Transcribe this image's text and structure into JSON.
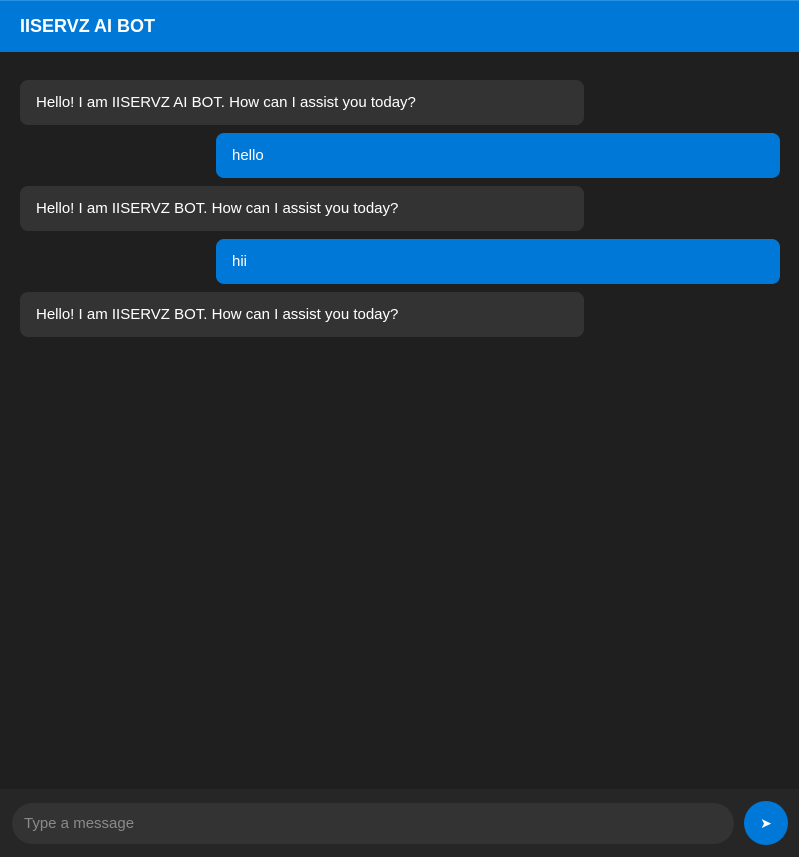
{
  "header": {
    "title": "IISERVZ AI BOT"
  },
  "messages": [
    {
      "role": "bot",
      "text": "Hello! I am IISERVZ AI BOT. How can I assist you today?"
    },
    {
      "role": "user",
      "text": "hello"
    },
    {
      "role": "bot",
      "text": "Hello! I am IISERVZ BOT. How can I assist you today?"
    },
    {
      "role": "user",
      "text": "hii"
    },
    {
      "role": "bot",
      "text": "Hello! I am IISERVZ BOT. How can I assist you today?"
    }
  ],
  "composer": {
    "value": "",
    "placeholder": "Type a message",
    "send_icon": "➤"
  },
  "colors": {
    "accent": "#0078d7",
    "background": "#1f1f1f",
    "bot_bubble": "#333333",
    "input_bar": "#262626"
  }
}
